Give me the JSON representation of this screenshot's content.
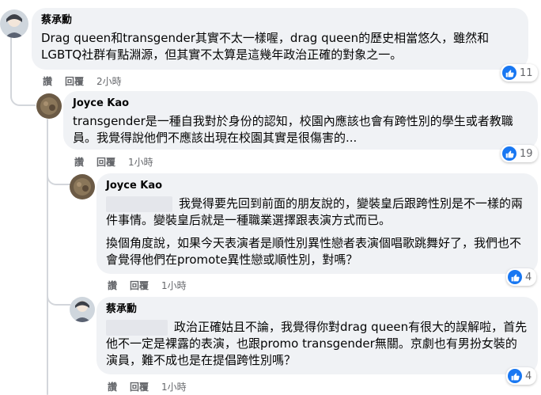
{
  "comments": [
    {
      "author": "蔡承勳",
      "text": "Drag queen和transgender其實不太一樣喔，drag queen的歷史相當悠久，雖然和LGBTQ社群有點淵源，但其實不太算是這幾年政治正確的對象之一。",
      "actions": {
        "like": "讚",
        "reply": "回覆",
        "time": "2小時"
      },
      "reactions": {
        "icon": "like-icon",
        "count": "11"
      }
    },
    {
      "author": "Joyce Kao",
      "text": "transgender是一種自我對於身份的認知，校園內應該也會有跨性別的學生或者教職員。我覺得說他們不應該出現在校園其實是很傷害的...",
      "actions": {
        "like": "讚",
        "reply": "回覆",
        "time": "1小時"
      },
      "reactions": {
        "icon": "like-icon",
        "count": "19"
      }
    },
    {
      "author": "Joyce Kao",
      "text1": "我覺得要先回到前面的朋友說的，變裝皇后跟跨性別是不一樣的兩件事情。變裝皇后就是一種職業選擇跟表演方式而已。",
      "text2": "換個角度說，如果今天表演者是順性別異性戀者表演個唱歌跳舞好了，我們也不會覺得他們在promote異性戀或順性別，對嗎？",
      "actions": {
        "like": "讚",
        "reply": "回覆",
        "time": "1小時"
      },
      "reactions": {
        "icon": "like-icon",
        "count": "4"
      }
    },
    {
      "author": "蔡承勳",
      "text": "政治正確姑且不論，我覺得你對drag queen有很大的誤解啦，首先他不一定是裸露的表演，也跟promo transgender無關。京劇也有男扮女裝的演員，難不成也是在提倡跨性別嗎？",
      "actions": {
        "like": "讚",
        "reply": "回覆",
        "time": "1小時"
      },
      "reactions": {
        "icon": "like-icon",
        "count": "4"
      }
    }
  ],
  "colors": {
    "bubble": "#f0f2f5",
    "like_blue": "#1877f2",
    "meta_gray": "#65676b"
  }
}
